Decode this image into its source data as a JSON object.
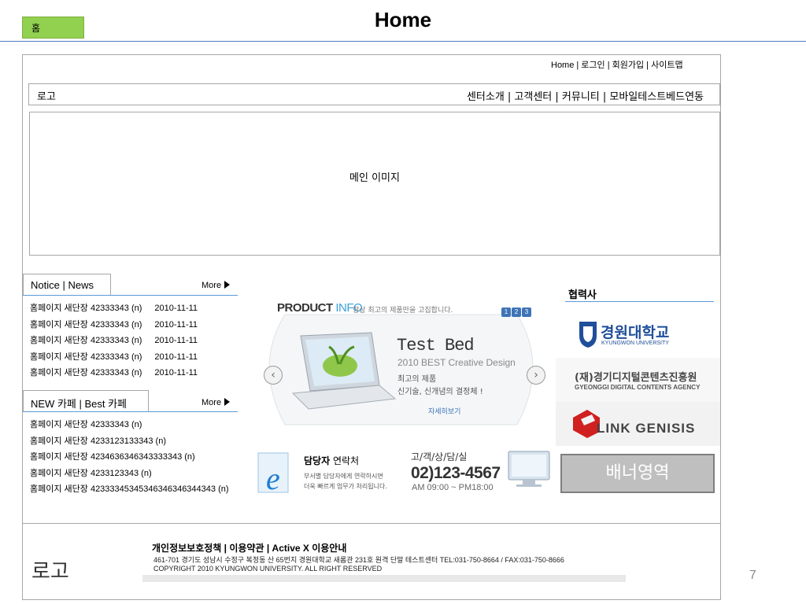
{
  "slide": {
    "tag": "홈",
    "title": "Home",
    "page_number": "7"
  },
  "top_links": "Home | 로그인 | 회원가입 | 사이트맵",
  "gnb": {
    "logo": "로고",
    "menu": "센터소개   | 고객센터 |   커뮤니티   |   모바일테스트베드연동"
  },
  "main_visual": {
    "label": "메인 이미지"
  },
  "notice": {
    "title": "Notice | News",
    "more": "More",
    "items": [
      {
        "text": "홈페이지 새단장 42333343 (n)",
        "date": "2010-11-11"
      },
      {
        "text": "홈페이지 새단장 42333343 (n)",
        "date": "2010-11-11"
      },
      {
        "text": "홈페이지 새단장 42333343 (n)",
        "date": "2010-11-11"
      },
      {
        "text": "홈페이지 새단장 42333343 (n)",
        "date": "2010-11-11"
      },
      {
        "text": "홈페이지 새단장 42333343 (n)",
        "date": "2010-11-11"
      }
    ]
  },
  "cafe": {
    "title": "NEW 카페 | Best 카페",
    "more": "More",
    "items": [
      "홈페이지 새단장 42333343 (n)",
      "홈페이지 새단장 4233123133343 (n)",
      "홈페이지 새단장 4234636346343333343 (n)",
      "홈페이지 새단장 4233123343 (n)",
      "홈페이지 새단장 42333345345346346346344343 (n)"
    ]
  },
  "product_info": {
    "head_bold": "PRODUCT",
    "head_info": "INFO",
    "head_sub": "항상 최고의 제품만을 고집합니다.",
    "pages": [
      "1",
      "2",
      "3"
    ],
    "prev": "‹",
    "next": "›",
    "title": "Test Bed",
    "subtitle": "2010 BEST Creative Design",
    "copy_line1": "최고의 제품",
    "copy_line2": "신기술, 신개념의 결정체 !",
    "detail": "자세히보기"
  },
  "contact": {
    "title_bold": "담당자",
    "title_rest": " 연락처",
    "line1": "부서별 담당자에게 연락하시면",
    "line2": "더욱 빠르게 업무가 처리됩니다."
  },
  "phone": {
    "label": "고/객/상/담/실",
    "number": "02)123-4567",
    "hours": "AM 09:00 ~ PM18:00"
  },
  "partners": {
    "title": "협력사",
    "items": [
      {
        "name": "경원대학교",
        "sub": "KYUNGWON UNIVERSITY"
      },
      {
        "name": "(재)경기디지털콘텐츠진흥원",
        "sub": "GYEONGGI DIGITAL CONTENTS AGENCY"
      },
      {
        "name": "LINK GENISIS"
      }
    ]
  },
  "banner": "배너영역",
  "footer": {
    "logo": "로고",
    "links": "개인정보보호정책  | 이용약관  | Active X 이용안내",
    "address": "461-701 경기도 성남시 수정구 복정동 산 65번지 경원대학교 새롬관 231호 원격 단말 테스트센터 TEL:031-750-8664 / FAX:031-750-8666",
    "copyright": "COPYRIGHT 2010 KYUNGWON UNIVERSITY.  ALL RIGHT RESERVED"
  },
  "colors": {
    "tag_green": "#92d050",
    "rule_blue": "#5b9bd5",
    "banner_gray": "#bfbfbf",
    "partner_blue": "#1f4e9a",
    "link_red": "#d02020"
  }
}
